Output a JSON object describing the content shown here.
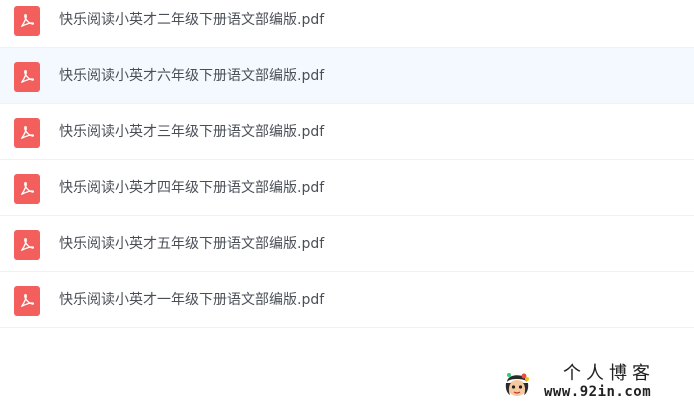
{
  "files": [
    {
      "name": "快乐阅读小英才二年级下册语文部编版.pdf",
      "icon": "pdf-icon"
    },
    {
      "name": "快乐阅读小英才六年级下册语文部编版.pdf",
      "icon": "pdf-icon"
    },
    {
      "name": "快乐阅读小英才三年级下册语文部编版.pdf",
      "icon": "pdf-icon"
    },
    {
      "name": "快乐阅读小英才四年级下册语文部编版.pdf",
      "icon": "pdf-icon"
    },
    {
      "name": "快乐阅读小英才五年级下册语文部编版.pdf",
      "icon": "pdf-icon"
    },
    {
      "name": "快乐阅读小英才一年级下册语文部编版.pdf",
      "icon": "pdf-icon"
    }
  ],
  "watermark": {
    "title": "个人博客",
    "url": "www.92in.com"
  },
  "colors": {
    "pdf_icon": "#f25f5c",
    "row_hover": "#f4f9ff",
    "text": "#4a4f57"
  }
}
